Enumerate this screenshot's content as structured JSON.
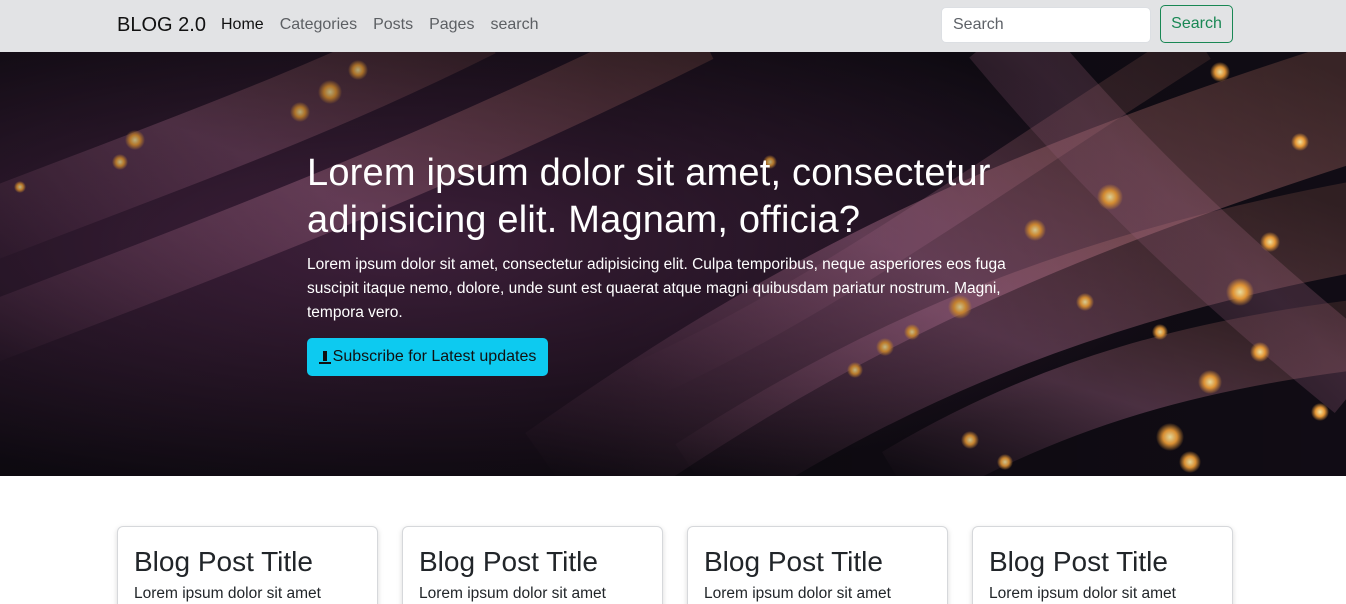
{
  "navbar": {
    "brand": "BLOG 2.0",
    "links": [
      {
        "label": "Home",
        "active": true
      },
      {
        "label": "Categories",
        "active": false
      },
      {
        "label": "Posts",
        "active": false
      },
      {
        "label": "Pages",
        "active": false
      },
      {
        "label": "search",
        "active": false
      }
    ],
    "search_placeholder": "Search",
    "search_button": "Search"
  },
  "hero": {
    "title": "Lorem ipsum dolor sit amet, consectetur adipisicing elit. Magnam, officia?",
    "text": "Lorem ipsum dolor sit amet, consectetur adipisicing elit. Culpa temporibus, neque asperiores eos fuga suscipit itaque nemo, dolore, unde sunt est quaerat atque magni quibusdam pariatur nostrum. Magni, tempora vero.",
    "button_label": "Subscribe for Latest updates",
    "button_icon": "download-icon"
  },
  "cards": [
    {
      "title": "Blog Post Title",
      "text": "Lorem ipsum dolor sit amet"
    },
    {
      "title": "Blog Post Title",
      "text": "Lorem ipsum dolor sit amet"
    },
    {
      "title": "Blog Post Title",
      "text": "Lorem ipsum dolor sit amet"
    },
    {
      "title": "Blog Post Title",
      "text": "Lorem ipsum dolor sit amet"
    }
  ],
  "colors": {
    "navbar_bg": "#e2e3e5",
    "search_button": "#198754",
    "subscribe_button": "#0dcaf0"
  }
}
